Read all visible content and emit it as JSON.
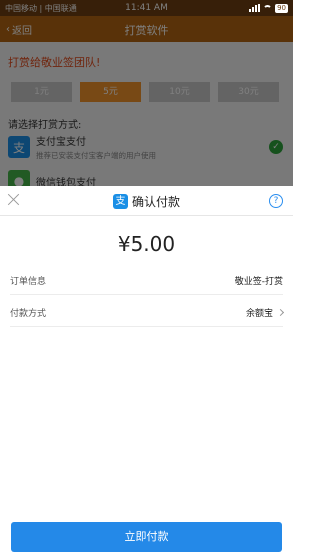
{
  "status_bar": {
    "carriers": "中国移动 | 中国联通",
    "time": "11:41 AM",
    "battery": "90"
  },
  "app_header": {
    "back_label": "返回",
    "title": "打赏软件"
  },
  "page": {
    "reward_title": "打赏给敬业签团队!",
    "amounts": [
      "1元",
      "5元",
      "10元",
      "30元"
    ],
    "selected_amount": "5元",
    "choose_label": "请选择打赏方式:",
    "methods": [
      {
        "name": "支付宝支付",
        "desc": "推荐已安装支付宝客户端的用户使用",
        "icon": "alipay-icon",
        "color": "#1a8fe6",
        "selected": true
      },
      {
        "name": "微信钱包支付",
        "desc": "",
        "icon": "wechat-icon",
        "color": "#44b549",
        "selected": false
      }
    ]
  },
  "sheet": {
    "title": "确认付款",
    "amount": "¥5.00",
    "order_label": "订单信息",
    "order_value": "敬业签-打赏",
    "method_label": "付款方式",
    "method_value": "余额宝",
    "pay_button": "立即付款"
  },
  "colors": {
    "header": "#b26512",
    "accent_orange": "#f0922b",
    "alipay_blue": "#2489e8"
  }
}
